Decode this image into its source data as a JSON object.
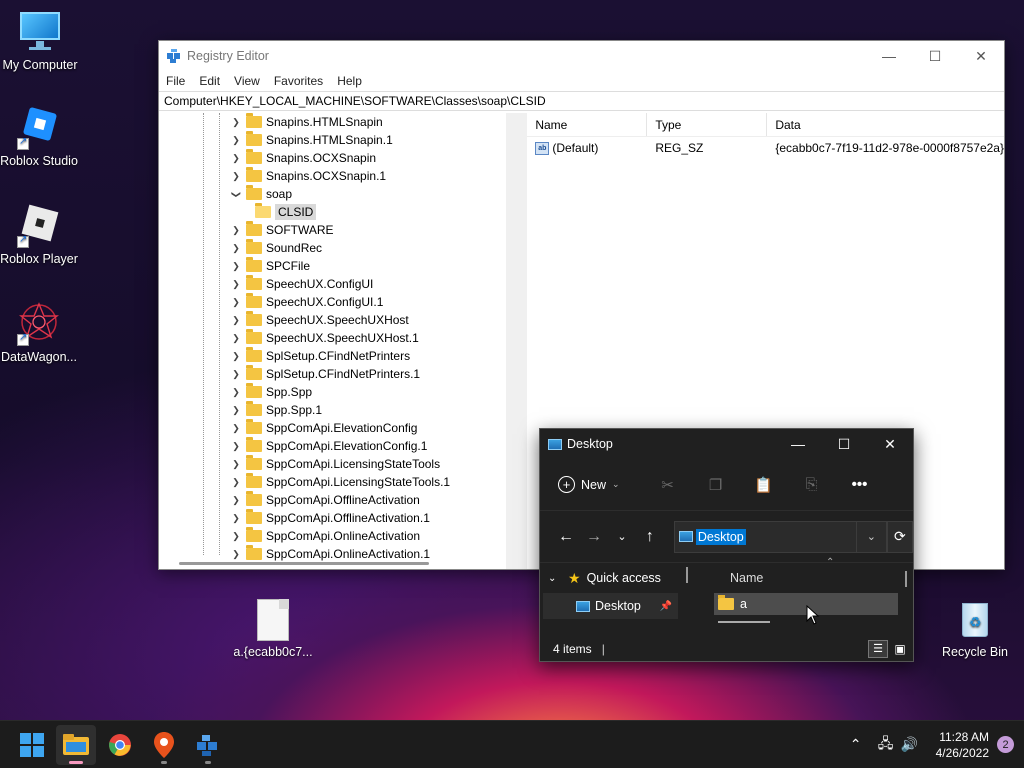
{
  "desktop": {
    "icons": [
      {
        "label": "My Computer"
      },
      {
        "label": "Roblox Studio"
      },
      {
        "label": "Roblox Player"
      },
      {
        "label": "DataWagon..."
      },
      {
        "label": "a.{ecabb0c7..."
      },
      {
        "label": "Recycle Bin"
      }
    ]
  },
  "regedit": {
    "title": "Registry Editor",
    "menu": [
      "File",
      "Edit",
      "View",
      "Favorites",
      "Help"
    ],
    "address": "Computer\\HKEY_LOCAL_MACHINE\\SOFTWARE\\Classes\\soap\\CLSID",
    "tree": [
      {
        "label": "Snapins.HTMLSnapin"
      },
      {
        "label": "Snapins.HTMLSnapin.1"
      },
      {
        "label": "Snapins.OCXSnapin"
      },
      {
        "label": "Snapins.OCXSnapin.1"
      },
      {
        "label": "soap"
      },
      {
        "label": "CLSID"
      },
      {
        "label": "SOFTWARE"
      },
      {
        "label": "SoundRec"
      },
      {
        "label": "SPCFile"
      },
      {
        "label": "SpeechUX.ConfigUI"
      },
      {
        "label": "SpeechUX.ConfigUI.1"
      },
      {
        "label": "SpeechUX.SpeechUXHost"
      },
      {
        "label": "SpeechUX.SpeechUXHost.1"
      },
      {
        "label": "SplSetup.CFindNetPrinters"
      },
      {
        "label": "SplSetup.CFindNetPrinters.1"
      },
      {
        "label": "Spp.Spp"
      },
      {
        "label": "Spp.Spp.1"
      },
      {
        "label": "SppComApi.ElevationConfig"
      },
      {
        "label": "SppComApi.ElevationConfig.1"
      },
      {
        "label": "SppComApi.LicensingStateTools"
      },
      {
        "label": "SppComApi.LicensingStateTools.1"
      },
      {
        "label": "SppComApi.OfflineActivation"
      },
      {
        "label": "SppComApi.OfflineActivation.1"
      },
      {
        "label": "SppComApi.OnlineActivation"
      },
      {
        "label": "SppComApi.OnlineActivation.1"
      }
    ],
    "columns": {
      "name": "Name",
      "type": "Type",
      "data": "Data"
    },
    "values": [
      {
        "name": "(Default)",
        "type": "REG_SZ",
        "data": "{ecabb0c7-7f19-11d2-978e-0000f8757e2a}"
      }
    ]
  },
  "explorer": {
    "title": "Desktop",
    "new_label": "New",
    "address": "Desktop",
    "quick_access": "Quick access",
    "nav_desktop": "Desktop",
    "col_name": "Name",
    "file": "a",
    "status": "4 items"
  },
  "taskbar": {
    "time": "11:28 AM",
    "date": "4/26/2022",
    "notifications": "2"
  }
}
